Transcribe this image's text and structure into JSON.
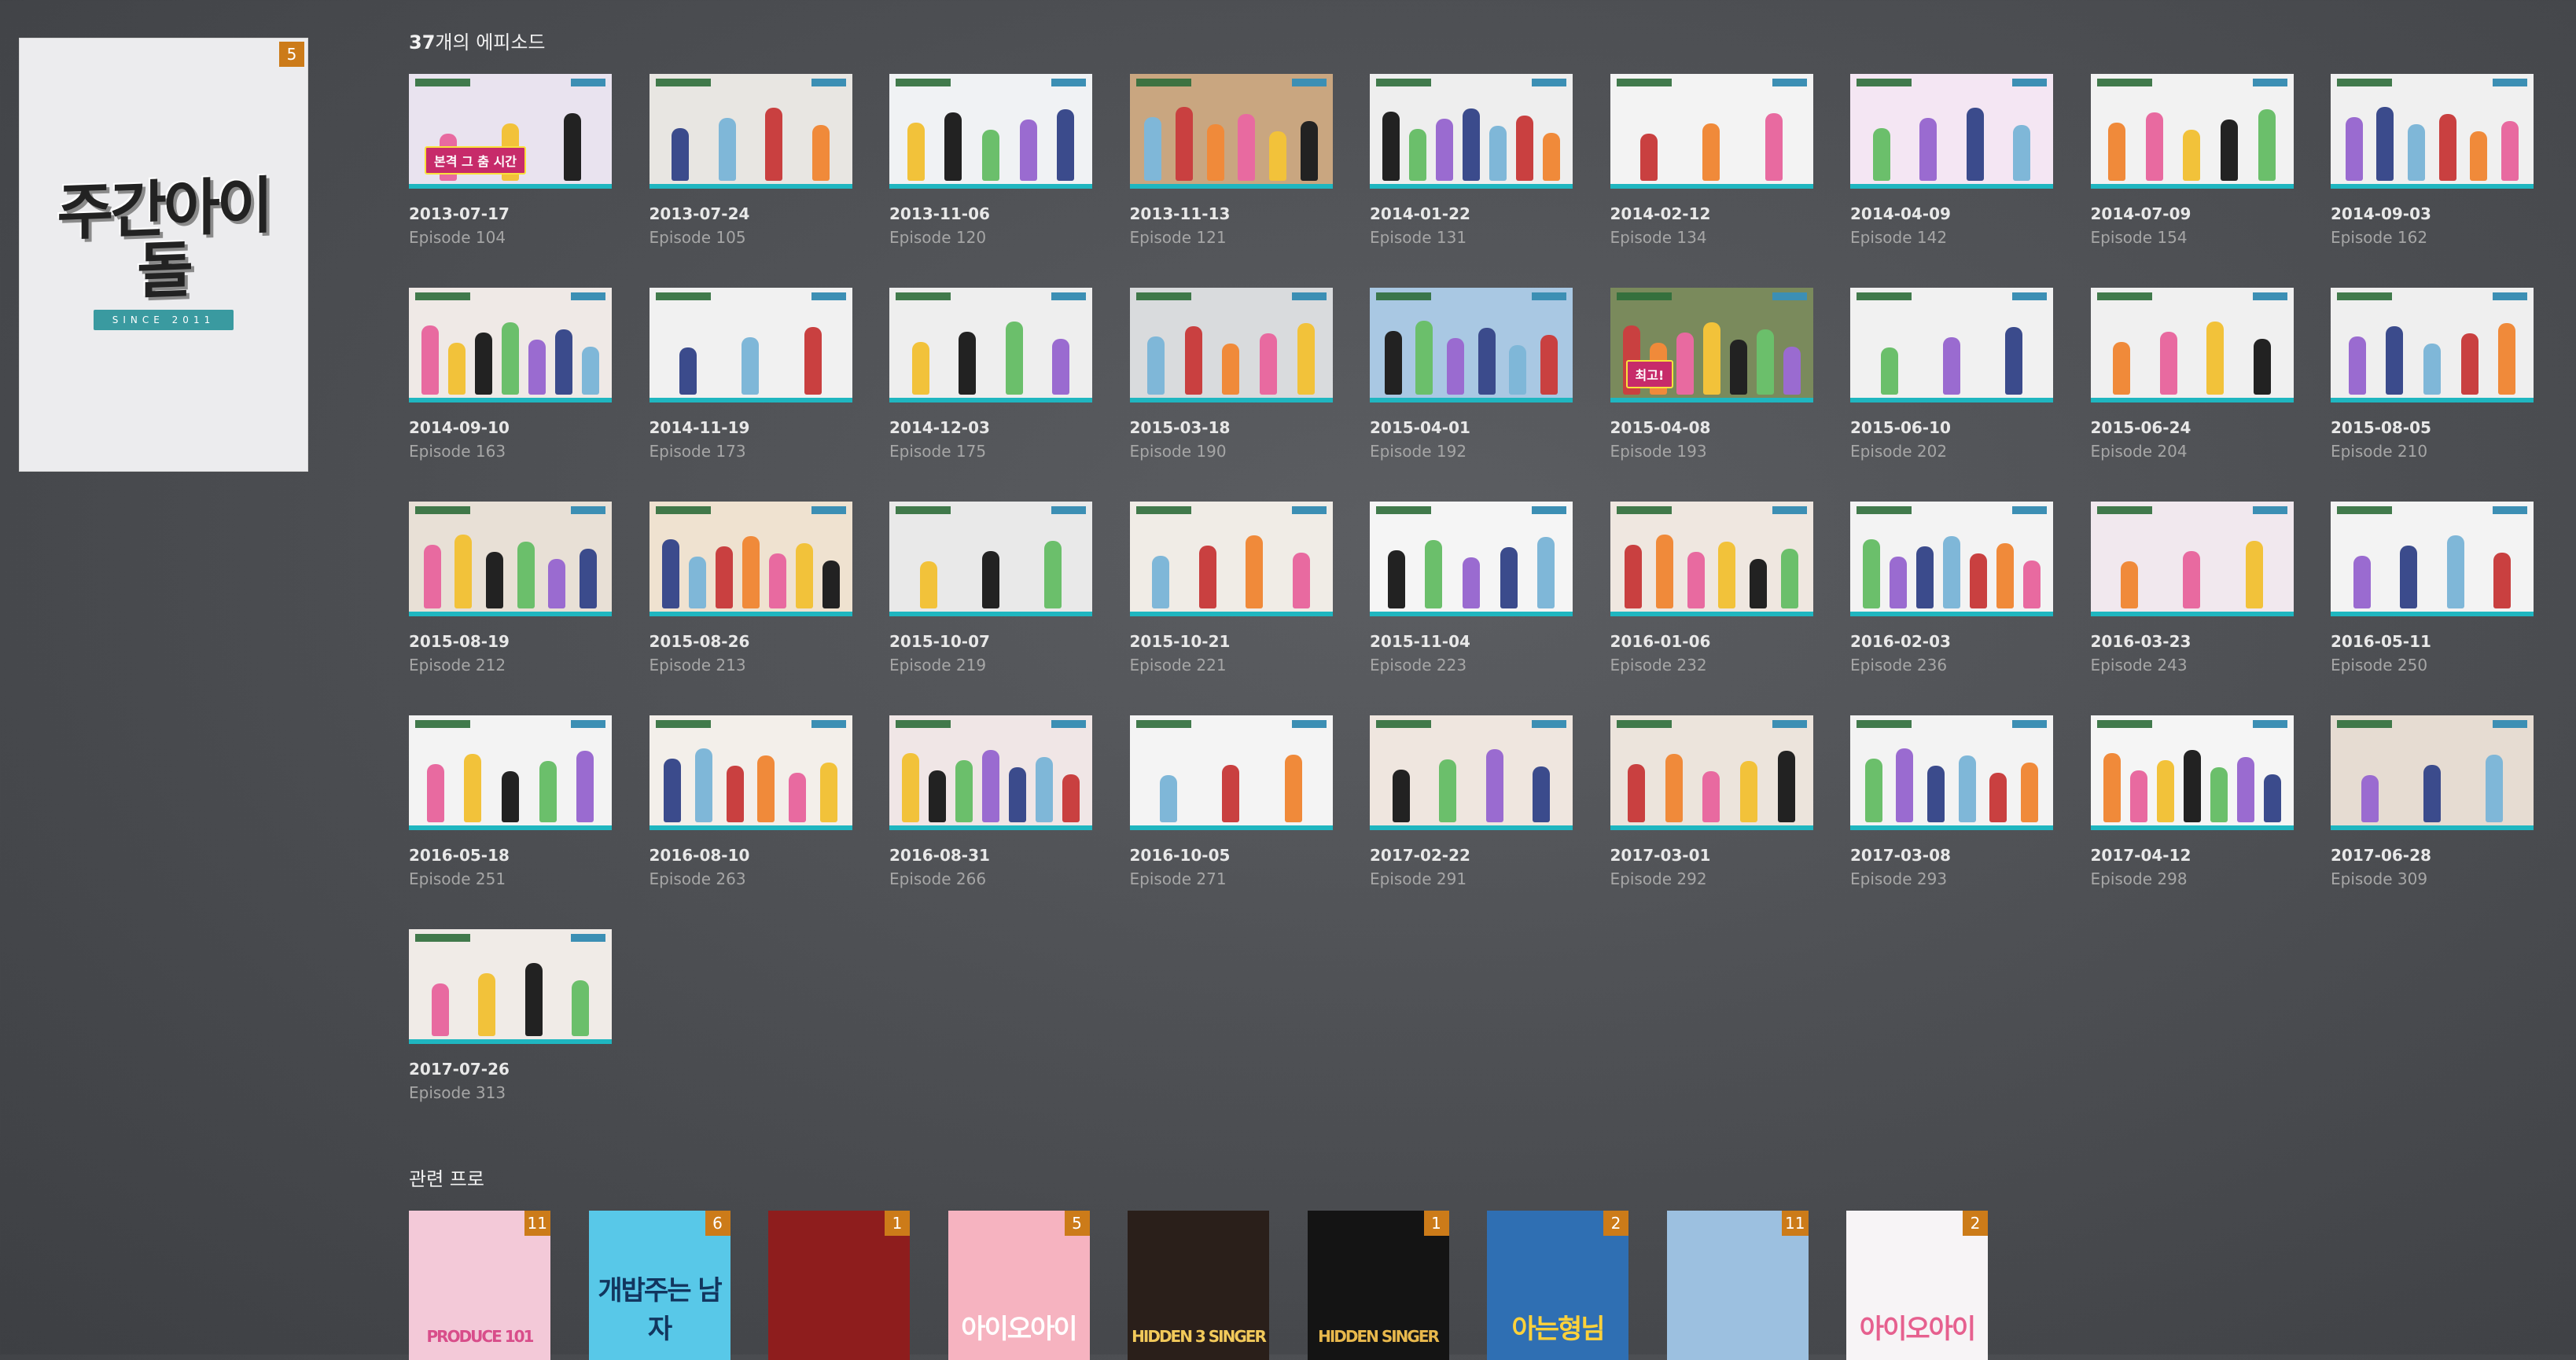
{
  "show": {
    "poster_logo": "주간아이돌",
    "poster_since": "SINCE 2011",
    "badge_count": "5"
  },
  "episodes_header": {
    "count": "37",
    "suffix": "개의 에피소드"
  },
  "episodes": [
    {
      "date": "2013-07-17",
      "episode": "Episode 104",
      "caption": "본격 그 춤 시간",
      "bg": "#e9e3ef"
    },
    {
      "date": "2013-07-24",
      "episode": "Episode 105",
      "caption": "",
      "bg": "#e8e6e2"
    },
    {
      "date": "2013-11-06",
      "episode": "Episode 120",
      "caption": "",
      "bg": "#f0f2f4"
    },
    {
      "date": "2013-11-13",
      "episode": "Episode 121",
      "caption": "",
      "bg": "#c9a680"
    },
    {
      "date": "2014-01-22",
      "episode": "Episode 131",
      "caption": "",
      "bg": "#eeeeee"
    },
    {
      "date": "2014-02-12",
      "episode": "Episode 134",
      "caption": "",
      "bg": "#f3f3f3"
    },
    {
      "date": "2014-04-09",
      "episode": "Episode 142",
      "caption": "",
      "bg": "#f4e6f3"
    },
    {
      "date": "2014-07-09",
      "episode": "Episode 154",
      "caption": "",
      "bg": "#f2f2f2"
    },
    {
      "date": "2014-09-03",
      "episode": "Episode 162",
      "caption": "",
      "bg": "#f0f0f0"
    },
    {
      "date": "2014-09-10",
      "episode": "Episode 163",
      "caption": "",
      "bg": "#efe9e6"
    },
    {
      "date": "2014-11-19",
      "episode": "Episode 173",
      "caption": "",
      "bg": "#f1f1f1"
    },
    {
      "date": "2014-12-03",
      "episode": "Episode 175",
      "caption": "",
      "bg": "#eeeeee"
    },
    {
      "date": "2015-03-18",
      "episode": "Episode 190",
      "caption": "",
      "bg": "#d9dbdd"
    },
    {
      "date": "2015-04-01",
      "episode": "Episode 192",
      "caption": "",
      "bg": "#a9c8e3"
    },
    {
      "date": "2015-04-08",
      "episode": "Episode 193",
      "caption": "최고!",
      "bg": "#7a8a5c"
    },
    {
      "date": "2015-06-10",
      "episode": "Episode 202",
      "caption": "",
      "bg": "#f1f1f1"
    },
    {
      "date": "2015-06-24",
      "episode": "Episode 204",
      "caption": "",
      "bg": "#f0f0f0"
    },
    {
      "date": "2015-08-05",
      "episode": "Episode 210",
      "caption": "",
      "bg": "#efefef"
    },
    {
      "date": "2015-08-19",
      "episode": "Episode 212",
      "caption": "",
      "bg": "#e8e0d6"
    },
    {
      "date": "2015-08-26",
      "episode": "Episode 213",
      "caption": "",
      "bg": "#efe2d0"
    },
    {
      "date": "2015-10-07",
      "episode": "Episode 219",
      "caption": "",
      "bg": "#e9e9e9"
    },
    {
      "date": "2015-10-21",
      "episode": "Episode 221",
      "caption": "",
      "bg": "#f0ece6"
    },
    {
      "date": "2015-11-04",
      "episode": "Episode 223",
      "caption": "",
      "bg": "#f5f5f5"
    },
    {
      "date": "2016-01-06",
      "episode": "Episode 232",
      "caption": "",
      "bg": "#efe7e0"
    },
    {
      "date": "2016-02-03",
      "episode": "Episode 236",
      "caption": "",
      "bg": "#f3f3f3"
    },
    {
      "date": "2016-03-23",
      "episode": "Episode 243",
      "caption": "",
      "bg": "#f1e8ee"
    },
    {
      "date": "2016-05-11",
      "episode": "Episode 250",
      "caption": "",
      "bg": "#f3f3f3"
    },
    {
      "date": "2016-05-18",
      "episode": "Episode 251",
      "caption": "",
      "bg": "#f3f3f3"
    },
    {
      "date": "2016-08-10",
      "episode": "Episode 263",
      "caption": "",
      "bg": "#f3efea"
    },
    {
      "date": "2016-08-31",
      "episode": "Episode 266",
      "caption": "",
      "bg": "#f0e6e6"
    },
    {
      "date": "2016-10-05",
      "episode": "Episode 271",
      "caption": "",
      "bg": "#f4f4f4"
    },
    {
      "date": "2017-02-22",
      "episode": "Episode 291",
      "caption": "",
      "bg": "#efe6df"
    },
    {
      "date": "2017-03-01",
      "episode": "Episode 292",
      "caption": "",
      "bg": "#ece4dc"
    },
    {
      "date": "2017-03-08",
      "episode": "Episode 293",
      "caption": "",
      "bg": "#f3f3f3"
    },
    {
      "date": "2017-04-12",
      "episode": "Episode 298",
      "caption": "",
      "bg": "#f5f5f5"
    },
    {
      "date": "2017-06-28",
      "episode": "Episode 309",
      "caption": "",
      "bg": "#e6dcd2"
    },
    {
      "date": "2017-07-26",
      "episode": "Episode 313",
      "caption": "",
      "bg": "#f0ebe7"
    }
  ],
  "related_header": "관련 프로",
  "related": [
    {
      "badge": "11",
      "title": "PRODUCE 101",
      "bg": "#f3c9d8",
      "color": "#d84d8a"
    },
    {
      "badge": "6",
      "title": "개밥주는 남자",
      "bg": "#58c8e8",
      "color": "#12355e"
    },
    {
      "badge": "1",
      "title": "",
      "bg": "#8e1d1d",
      "color": "#f6d066"
    },
    {
      "badge": "5",
      "title": "아이오아이",
      "bg": "#f6b3c0",
      "color": "#ffffff"
    },
    {
      "badge": "",
      "title": "HIDDEN 3 SINGER",
      "bg": "#2a1f1a",
      "color": "#f2c95a"
    },
    {
      "badge": "1",
      "title": "HIDDEN SINGER",
      "bg": "#141414",
      "color": "#e8b84c"
    },
    {
      "badge": "2",
      "title": "아는형님",
      "bg": "#2f6fb3",
      "color": "#ffd23a"
    },
    {
      "badge": "11",
      "title": "",
      "bg": "#9cc0e0",
      "color": "#ffffff"
    },
    {
      "badge": "2",
      "title": "아이오아이",
      "bg": "#f7f4f6",
      "color": "#e6608f"
    }
  ]
}
